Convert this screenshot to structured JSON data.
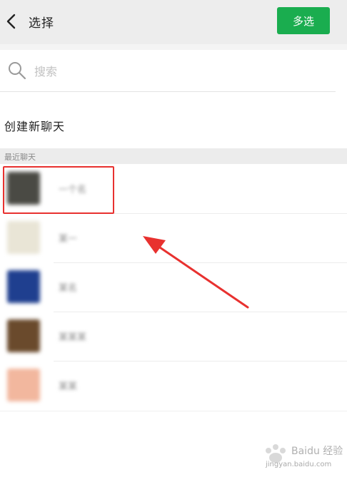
{
  "header": {
    "title": "选择",
    "multi_select_label": "多选"
  },
  "search": {
    "placeholder": "搜索"
  },
  "new_chat": {
    "label": "创建新聊天"
  },
  "recent": {
    "section_label": "最近聊天",
    "contacts": [
      {
        "name": "一个名",
        "avatar_color": "#4a4a44"
      },
      {
        "name": "某一",
        "avatar_color": "#e9e5d6"
      },
      {
        "name": "某名",
        "avatar_color": "#1f3f8f"
      },
      {
        "name": "某某某",
        "avatar_color": "#6a4a2c"
      },
      {
        "name": "某某",
        "avatar_color": "#f2b79e"
      }
    ]
  },
  "annotation": {
    "highlight_color": "#e8312f"
  },
  "watermark": {
    "brand": "Baidu 经验",
    "url": "jingyan.baidu.com"
  }
}
